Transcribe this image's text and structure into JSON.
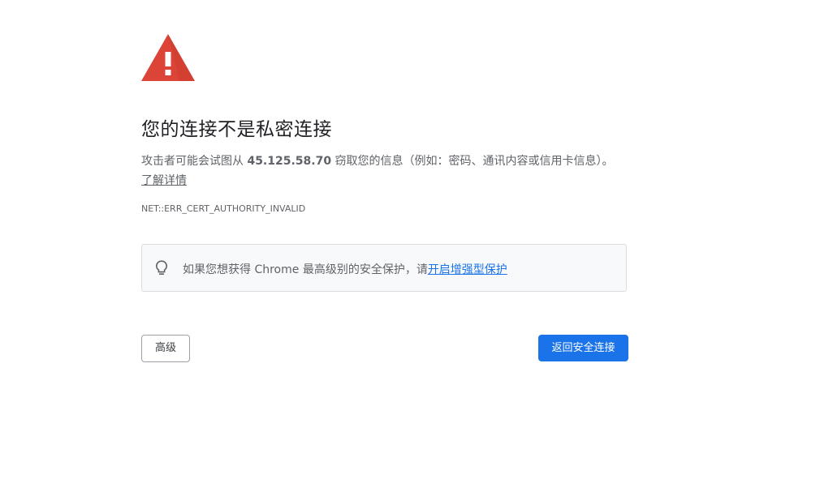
{
  "page": {
    "heading": "您的连接不是私密连接",
    "explanation": {
      "before_ip": "攻击者可能会试图从 ",
      "ip": "45.125.58.70",
      "after_ip": " 窃取您的信息（例如：密码、通讯内容或信用卡信息）。",
      "learn_more": "了解详情"
    },
    "error_code": "NET::ERR_CERT_AUTHORITY_INVALID",
    "protection": {
      "text": "如果您想获得 Chrome 最高级别的安全保护，请",
      "link": "开启增强型保护"
    },
    "buttons": {
      "advanced": "高级",
      "back_to_safety": "返回安全连接"
    }
  },
  "colors": {
    "warning_red": "#db4437",
    "link_blue": "#1a73e8",
    "primary_button": "#1a73e8"
  },
  "icons": {
    "warning": "warning-triangle-icon",
    "protection": "lightbulb-icon"
  }
}
